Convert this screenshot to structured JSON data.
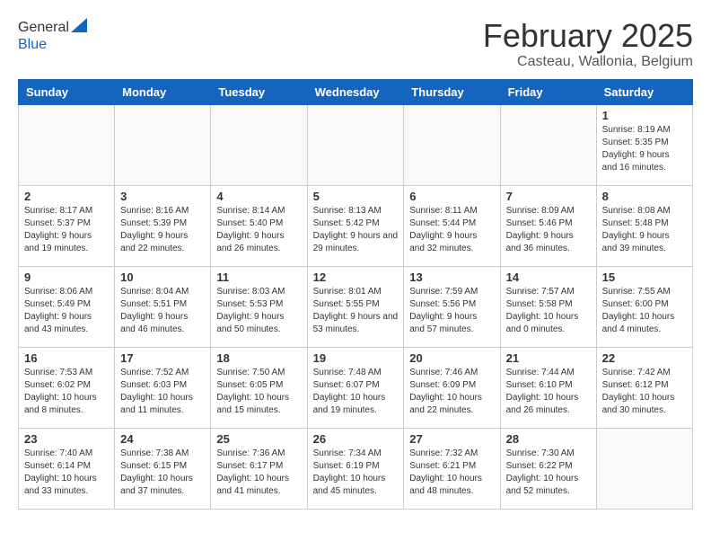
{
  "header": {
    "logo_general": "General",
    "logo_blue": "Blue",
    "month_title": "February 2025",
    "location": "Casteau, Wallonia, Belgium"
  },
  "days_of_week": [
    "Sunday",
    "Monday",
    "Tuesday",
    "Wednesday",
    "Thursday",
    "Friday",
    "Saturday"
  ],
  "weeks": [
    [
      {
        "day": "",
        "info": ""
      },
      {
        "day": "",
        "info": ""
      },
      {
        "day": "",
        "info": ""
      },
      {
        "day": "",
        "info": ""
      },
      {
        "day": "",
        "info": ""
      },
      {
        "day": "",
        "info": ""
      },
      {
        "day": "1",
        "info": "Sunrise: 8:19 AM\nSunset: 5:35 PM\nDaylight: 9 hours and 16 minutes."
      }
    ],
    [
      {
        "day": "2",
        "info": "Sunrise: 8:17 AM\nSunset: 5:37 PM\nDaylight: 9 hours and 19 minutes."
      },
      {
        "day": "3",
        "info": "Sunrise: 8:16 AM\nSunset: 5:39 PM\nDaylight: 9 hours and 22 minutes."
      },
      {
        "day": "4",
        "info": "Sunrise: 8:14 AM\nSunset: 5:40 PM\nDaylight: 9 hours and 26 minutes."
      },
      {
        "day": "5",
        "info": "Sunrise: 8:13 AM\nSunset: 5:42 PM\nDaylight: 9 hours and 29 minutes."
      },
      {
        "day": "6",
        "info": "Sunrise: 8:11 AM\nSunset: 5:44 PM\nDaylight: 9 hours and 32 minutes."
      },
      {
        "day": "7",
        "info": "Sunrise: 8:09 AM\nSunset: 5:46 PM\nDaylight: 9 hours and 36 minutes."
      },
      {
        "day": "8",
        "info": "Sunrise: 8:08 AM\nSunset: 5:48 PM\nDaylight: 9 hours and 39 minutes."
      }
    ],
    [
      {
        "day": "9",
        "info": "Sunrise: 8:06 AM\nSunset: 5:49 PM\nDaylight: 9 hours and 43 minutes."
      },
      {
        "day": "10",
        "info": "Sunrise: 8:04 AM\nSunset: 5:51 PM\nDaylight: 9 hours and 46 minutes."
      },
      {
        "day": "11",
        "info": "Sunrise: 8:03 AM\nSunset: 5:53 PM\nDaylight: 9 hours and 50 minutes."
      },
      {
        "day": "12",
        "info": "Sunrise: 8:01 AM\nSunset: 5:55 PM\nDaylight: 9 hours and 53 minutes."
      },
      {
        "day": "13",
        "info": "Sunrise: 7:59 AM\nSunset: 5:56 PM\nDaylight: 9 hours and 57 minutes."
      },
      {
        "day": "14",
        "info": "Sunrise: 7:57 AM\nSunset: 5:58 PM\nDaylight: 10 hours and 0 minutes."
      },
      {
        "day": "15",
        "info": "Sunrise: 7:55 AM\nSunset: 6:00 PM\nDaylight: 10 hours and 4 minutes."
      }
    ],
    [
      {
        "day": "16",
        "info": "Sunrise: 7:53 AM\nSunset: 6:02 PM\nDaylight: 10 hours and 8 minutes."
      },
      {
        "day": "17",
        "info": "Sunrise: 7:52 AM\nSunset: 6:03 PM\nDaylight: 10 hours and 11 minutes."
      },
      {
        "day": "18",
        "info": "Sunrise: 7:50 AM\nSunset: 6:05 PM\nDaylight: 10 hours and 15 minutes."
      },
      {
        "day": "19",
        "info": "Sunrise: 7:48 AM\nSunset: 6:07 PM\nDaylight: 10 hours and 19 minutes."
      },
      {
        "day": "20",
        "info": "Sunrise: 7:46 AM\nSunset: 6:09 PM\nDaylight: 10 hours and 22 minutes."
      },
      {
        "day": "21",
        "info": "Sunrise: 7:44 AM\nSunset: 6:10 PM\nDaylight: 10 hours and 26 minutes."
      },
      {
        "day": "22",
        "info": "Sunrise: 7:42 AM\nSunset: 6:12 PM\nDaylight: 10 hours and 30 minutes."
      }
    ],
    [
      {
        "day": "23",
        "info": "Sunrise: 7:40 AM\nSunset: 6:14 PM\nDaylight: 10 hours and 33 minutes."
      },
      {
        "day": "24",
        "info": "Sunrise: 7:38 AM\nSunset: 6:15 PM\nDaylight: 10 hours and 37 minutes."
      },
      {
        "day": "25",
        "info": "Sunrise: 7:36 AM\nSunset: 6:17 PM\nDaylight: 10 hours and 41 minutes."
      },
      {
        "day": "26",
        "info": "Sunrise: 7:34 AM\nSunset: 6:19 PM\nDaylight: 10 hours and 45 minutes."
      },
      {
        "day": "27",
        "info": "Sunrise: 7:32 AM\nSunset: 6:21 PM\nDaylight: 10 hours and 48 minutes."
      },
      {
        "day": "28",
        "info": "Sunrise: 7:30 AM\nSunset: 6:22 PM\nDaylight: 10 hours and 52 minutes."
      },
      {
        "day": "",
        "info": ""
      }
    ]
  ]
}
